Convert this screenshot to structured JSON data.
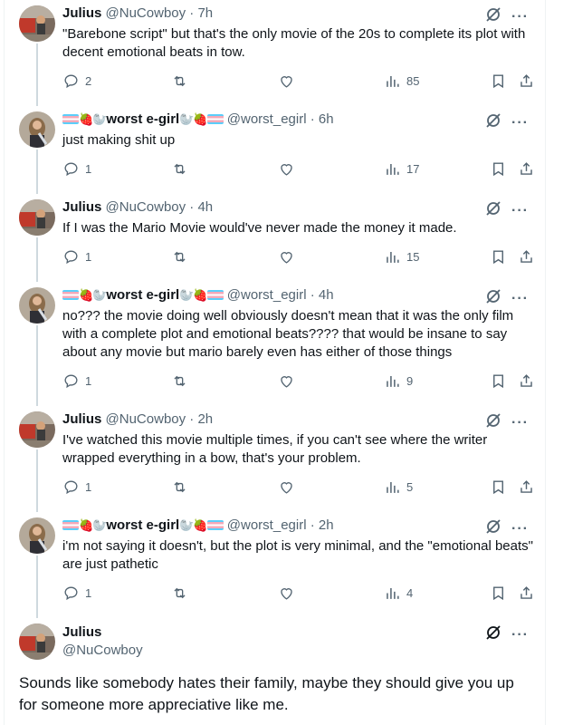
{
  "tweets": [
    {
      "name": "Julius",
      "handle": "@NuCowboy",
      "time": "7h",
      "text": "\"Barebone script\" but that's the only movie of the 20s to complete its plot with decent emotional beats in tow.",
      "replies": "2",
      "views": "85",
      "user": "julius"
    },
    {
      "name": "worst e-girl",
      "handle": "@worst_egirl",
      "time": "6h",
      "text": "just making shit up",
      "replies": "1",
      "views": "17",
      "user": "egirl"
    },
    {
      "name": "Julius",
      "handle": "@NuCowboy",
      "time": "4h",
      "text": "If I was the Mario Movie would've never made the money it made.",
      "replies": "1",
      "views": "15",
      "user": "julius"
    },
    {
      "name": "worst e-girl",
      "handle": "@worst_egirl",
      "time": "4h",
      "text": "no??? the movie doing well obviously doesn't mean that it was the only film with a complete plot and emotional beats???? that would be insane to say about any movie but mario barely even has either of those things",
      "replies": "1",
      "views": "9",
      "user": "egirl"
    },
    {
      "name": "Julius",
      "handle": "@NuCowboy",
      "time": "2h",
      "text": "I've watched this movie multiple times, if you can't see where the writer wrapped everything in a bow, that's your problem.",
      "replies": "1",
      "views": "5",
      "user": "julius"
    },
    {
      "name": "worst e-girl",
      "handle": "@worst_egirl",
      "time": "2h",
      "text": "i'm not saying it doesn't, but the plot is very minimal, and the \"emotional beats\" are just pathetic",
      "replies": "1",
      "views": "4",
      "user": "egirl"
    }
  ],
  "main_tweet": {
    "name": "Julius",
    "handle": "@NuCowboy",
    "text": "Sounds like somebody hates their family, maybe they should give you up for someone more appreciative like me."
  },
  "icons": {
    "more": "···"
  },
  "colors": {
    "secondary": "#536471",
    "thread": "#cfd9de"
  }
}
